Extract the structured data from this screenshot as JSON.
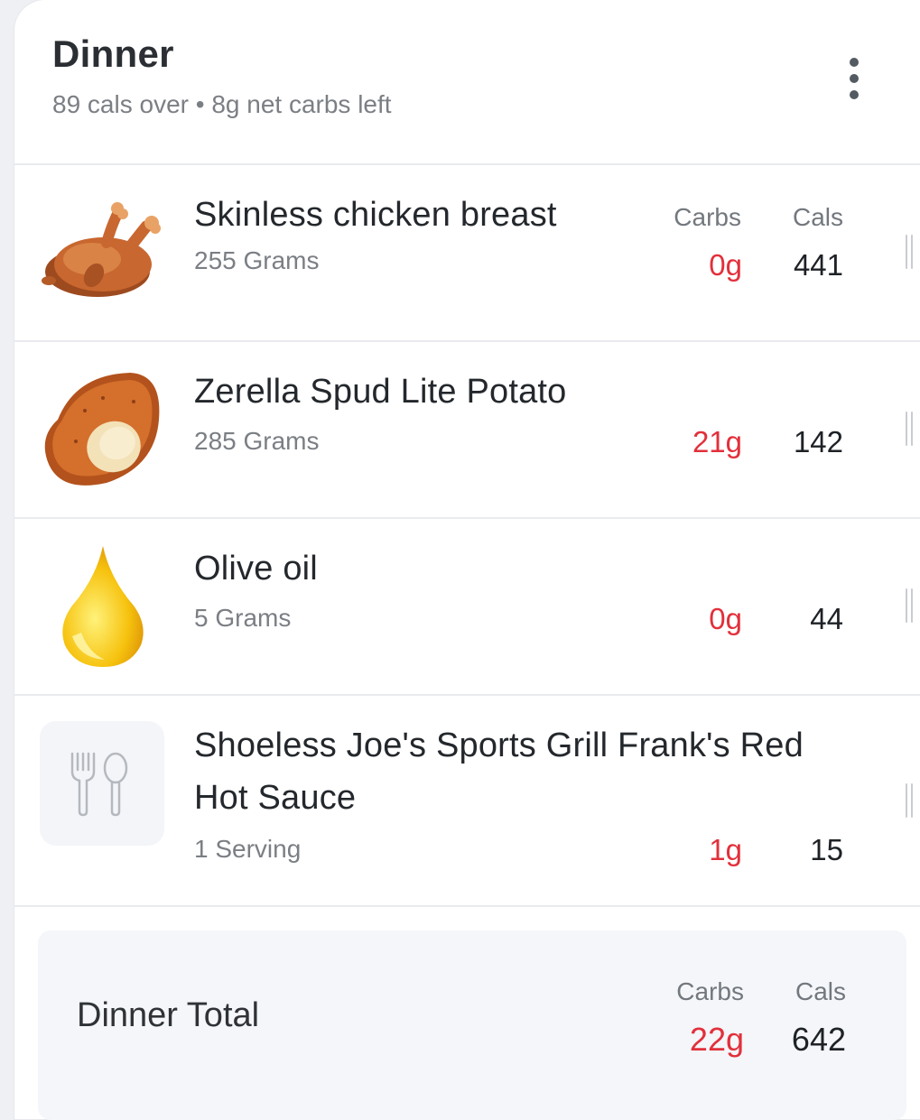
{
  "meal": {
    "title": "Dinner",
    "subtitle": "89 cals over • 8g net carbs left"
  },
  "columns": {
    "carbs": "Carbs",
    "cals": "Cals"
  },
  "items": [
    {
      "name": "Skinless chicken breast",
      "qty": "255 Grams",
      "carbs": "0g",
      "cals": "441",
      "icon": "roast-chicken-icon"
    },
    {
      "name": "Zerella Spud Lite Potato",
      "qty": "285 Grams",
      "carbs": "21g",
      "cals": "142",
      "icon": "potato-icon"
    },
    {
      "name": "Olive oil",
      "qty": "5 Grams",
      "carbs": "0g",
      "cals": "44",
      "icon": "oil-drop-icon"
    },
    {
      "name": "Shoeless Joe's Sports Grill Frank's Red Hot Sauce",
      "qty": "1 Serving",
      "carbs": "1g",
      "cals": "15",
      "icon": "fork-spoon-icon"
    }
  ],
  "total": {
    "label": "Dinner Total",
    "carbs": "22g",
    "cals": "642"
  },
  "colors": {
    "carbs": "#e2303b",
    "text": "#24282c",
    "muted": "#7b7f84"
  }
}
